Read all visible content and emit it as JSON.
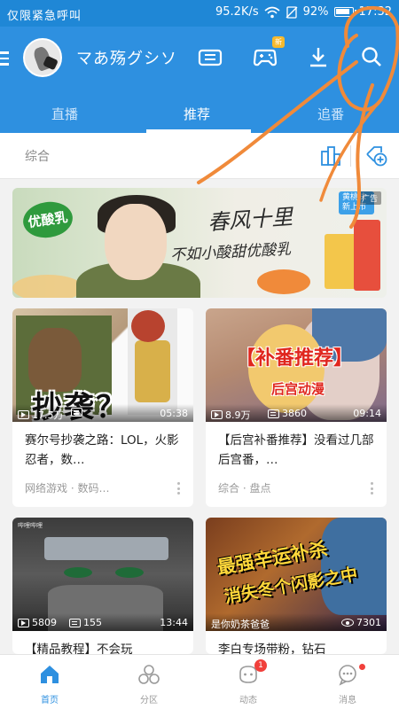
{
  "status_bar": {
    "carrier": "仅限紧急呼叫",
    "speed": "95.2K/s",
    "battery_pct": "92%",
    "time": "17:32",
    "icons": [
      "wifi-icon",
      "no-sim-icon",
      "battery-icon"
    ]
  },
  "header": {
    "username": "マあ殇グシソ",
    "new_badge": "新",
    "icons": [
      "menu-icon",
      "avatar",
      "inbox-icon",
      "game-controller-icon",
      "download-icon",
      "search-icon"
    ]
  },
  "tabs": [
    {
      "label": "直播",
      "active": false
    },
    {
      "label": "推荐",
      "active": true
    },
    {
      "label": "追番",
      "active": false
    }
  ],
  "category_bar": {
    "label": "综合",
    "icons": [
      "buildings-icon",
      "add-tag-icon"
    ]
  },
  "banner": {
    "brand": "优酸乳",
    "slogan_line1": "春风十里",
    "slogan_line2": "不如小酸甜优酸乳",
    "new_flavor": "黄桃味新上市",
    "ad_tag": "广告"
  },
  "cards": [
    {
      "thumb_text": "抄袭？",
      "plays": "17.5万",
      "comments": "",
      "duration": "05:38",
      "title": "赛尔号抄袭之路：LOL，火影忍者，数…",
      "tag1": "网络游戏",
      "tag2": "数码…"
    },
    {
      "thumb_text": "【补番推荐】",
      "thumb_subtext": "后宫动漫",
      "plays": "8.9万",
      "comments": "3860",
      "duration": "09:14",
      "title": "【后宫补番推荐】没看过几部后宫番，…",
      "tag1": "综合",
      "tag2": "盘点"
    },
    {
      "thumb_logo": "哔哩哔哩",
      "plays": "5809",
      "comments": "155",
      "duration": "13:44",
      "title": "【精品教程】不会玩"
    },
    {
      "thumb_text1": "最强辛运补杀",
      "thumb_text2": "消失冬个闪影之中",
      "caption": "是你奶茶爸爸",
      "views": "7301",
      "title": "李白专场带粉，钻石"
    }
  ],
  "bottom_nav": [
    {
      "label": "首页",
      "icon": "home-icon",
      "active": true
    },
    {
      "label": "分区",
      "icon": "category-icon",
      "active": false
    },
    {
      "label": "动态",
      "icon": "dynamics-icon",
      "active": false,
      "badge": "1"
    },
    {
      "label": "消息",
      "icon": "message-icon",
      "active": false
    }
  ],
  "colors": {
    "brand_blue": "#2e90e0",
    "status_blue": "#1f87d6",
    "annotation_orange": "#f08a3a",
    "badge_red": "#f1403b"
  }
}
